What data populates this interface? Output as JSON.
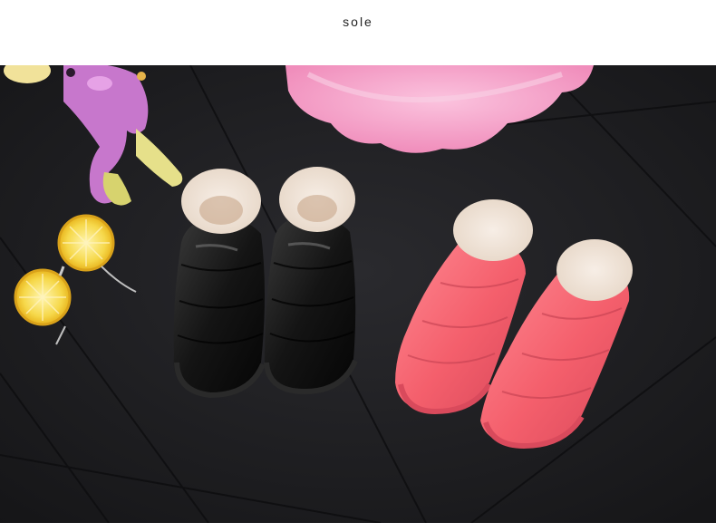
{
  "header": {
    "title": "sole"
  },
  "photo": {
    "subject": "",
    "colors": {
      "floor": "#1e1e21",
      "pink_shoe": "#f2646f",
      "black_shoe": "#141414",
      "plush_pink": "#f6a7cc",
      "toy_purple": "#c777cc",
      "lemon": "#f4cf2b"
    }
  }
}
